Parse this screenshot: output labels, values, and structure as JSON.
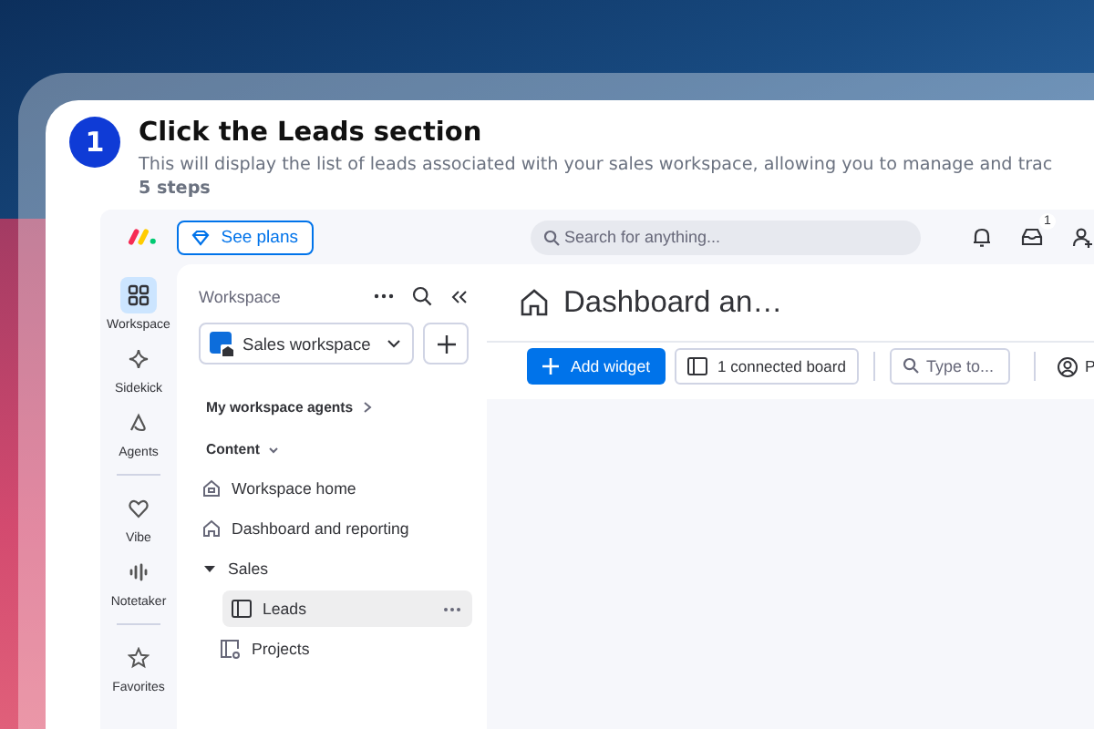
{
  "tutorial": {
    "step_number": "1",
    "title": "Click the Leads section",
    "description": "This will display the list of leads associated with your sales workspace, allowing you to manage and trac",
    "steps_count": "5 steps"
  },
  "top_bar": {
    "plans_button": "See plans",
    "search": {
      "placeholder": "Search for anything..."
    },
    "inbox_badge": "1"
  },
  "rail_sections": [
    [
      {
        "label": "Workspace",
        "kind": "grid",
        "selected": true
      },
      {
        "label": "Sidekick",
        "kind": "sparkle",
        "selected": false
      },
      {
        "label": "Agents",
        "kind": "agent",
        "selected": false
      }
    ],
    [
      {
        "label": "Vibe",
        "kind": "heart",
        "selected": false
      },
      {
        "label": "Notetaker",
        "kind": "wave",
        "selected": false
      }
    ],
    [
      {
        "label": "Favorites",
        "kind": "star",
        "selected": false
      }
    ]
  ],
  "workspace_panel": {
    "heading": "Workspace",
    "workspace_selector": "Sales workspace",
    "agents_link": "My workspace agents",
    "content_label": "Content",
    "tree": [
      {
        "label": "Workspace home",
        "kind": "home",
        "selected": false
      },
      {
        "label": "Dashboard and reporting",
        "kind": "dashboard",
        "selected": false
      },
      {
        "label": "Sales",
        "kind": "folder",
        "selected": false,
        "expanded": true,
        "children": [
          {
            "label": "Leads",
            "kind": "board",
            "selected": true
          },
          {
            "label": "Projects",
            "kind": "project",
            "selected": false
          }
        ]
      }
    ]
  },
  "dashboard": {
    "title": "Dashboard an…",
    "add_button": "Add widget",
    "connected_boards": "1 connected board",
    "filter": {
      "placeholder": "Type to..."
    },
    "person_button": "P"
  }
}
